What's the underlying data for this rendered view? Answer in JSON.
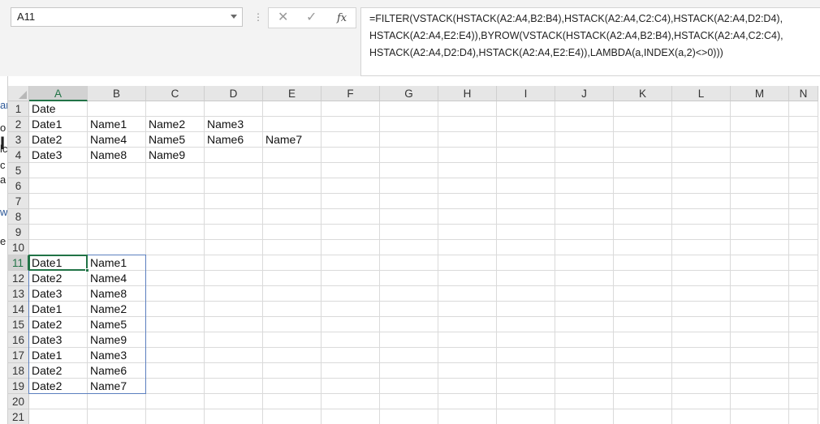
{
  "name_box": {
    "value": "A11"
  },
  "formula_bar": {
    "cancel_glyph": "✕",
    "confirm_glyph": "✓",
    "fx_label": "fx",
    "formula": "=FILTER(VSTACK(HSTACK(A2:A4,B2:B4),HSTACK(A2:A4,C2:C4),HSTACK(A2:A4,D2:D4),\nHSTACK(A2:A4,E2:E4)),BYROW(VSTACK(HSTACK(A2:A4,B2:B4),HSTACK(A2:A4,C2:C4),\nHSTACK(A2:A4,D2:D4),HSTACK(A2:A4,E2:E4)),LAMBDA(a,INDEX(a,2)<>0)))"
  },
  "left_strip_fragments": [
    "ar",
    "I",
    "o",
    "lc",
    "c",
    "a",
    "w",
    "e"
  ],
  "columns": [
    "A",
    "B",
    "C",
    "D",
    "E",
    "F",
    "G",
    "H",
    "I",
    "J",
    "K",
    "L",
    "M",
    "N"
  ],
  "rows": [
    "1",
    "2",
    "3",
    "4",
    "5",
    "6",
    "7",
    "8",
    "9",
    "10",
    "11",
    "12",
    "13",
    "14",
    "15",
    "16",
    "17",
    "18",
    "19",
    "20",
    "21"
  ],
  "selected_cell": {
    "col": "A",
    "row": "11"
  },
  "cells": {
    "A1": "Date",
    "A2": "Date1",
    "B2": "Name1",
    "C2": "Name2",
    "D2": "Name3",
    "A3": "Date2",
    "B3": "Name4",
    "C3": "Name5",
    "D3": "Name6",
    "E3": "Name7",
    "A4": "Date3",
    "B4": "Name8",
    "C4": "Name9",
    "A11": "Date1",
    "B11": "Name1",
    "A12": "Date2",
    "B12": "Name4",
    "A13": "Date3",
    "B13": "Name8",
    "A14": "Date1",
    "B14": "Name2",
    "A15": "Date2",
    "B15": "Name5",
    "A16": "Date3",
    "B16": "Name9",
    "A17": "Date1",
    "B17": "Name3",
    "A18": "Date2",
    "B18": "Name6",
    "A19": "Date2",
    "B19": "Name7"
  },
  "colors": {
    "accent": "#217346",
    "range_outline": "#5b7fbf"
  }
}
